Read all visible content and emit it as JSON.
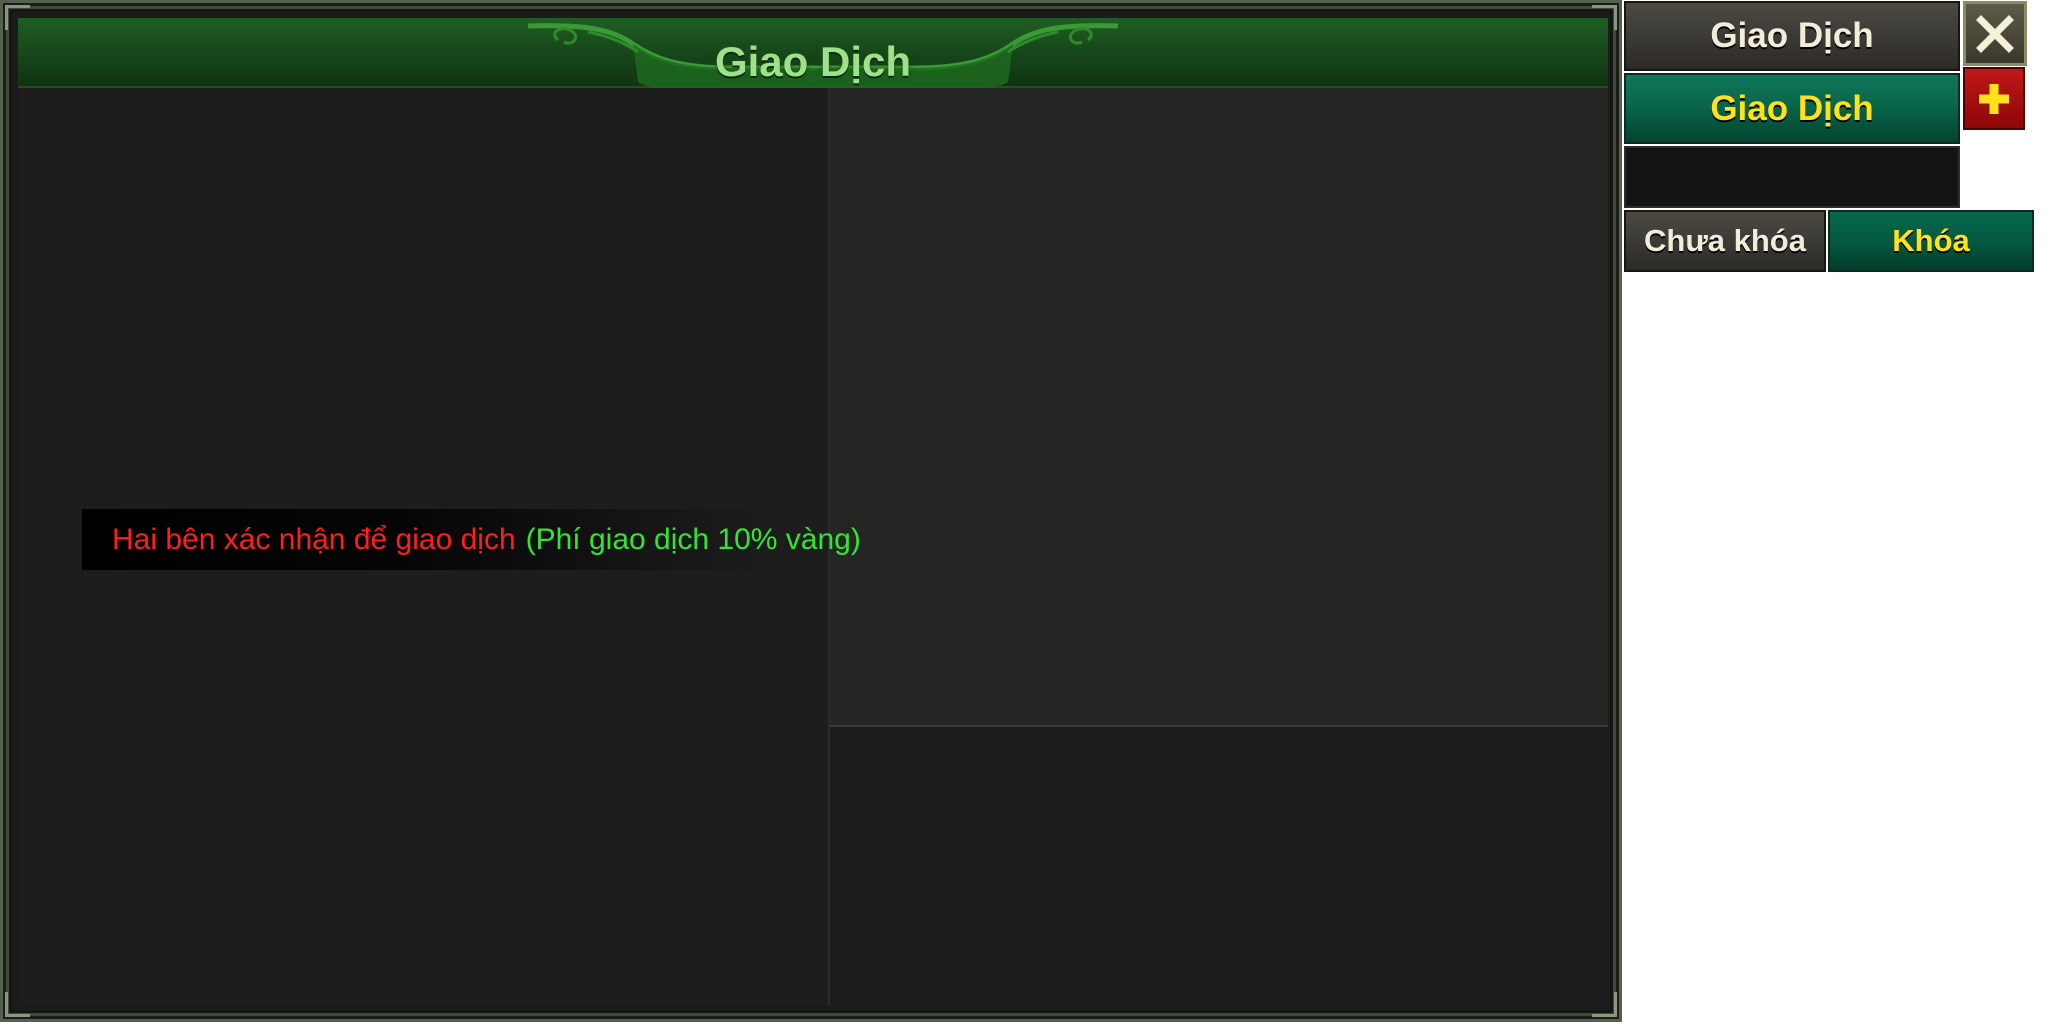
{
  "window": {
    "title": "Giao Dịch",
    "notice_red": "Hai bên xác nhận để giao dịch",
    "notice_green": "(Phí giao dịch 10% vàng)"
  },
  "side_panel": {
    "partner_label": "Giao Dịch",
    "self_label": "Giao Dịch",
    "unlock_label": "Chưa khóa",
    "lock_label": "Khóa",
    "close_icon": "close-icon",
    "add_icon": "plus-icon"
  },
  "colors": {
    "title_text": "#9fe08a",
    "notice_red": "#ff1e1e",
    "notice_green": "#35e335",
    "active_button_text": "#ffe21a",
    "add_button": "#c11818"
  }
}
